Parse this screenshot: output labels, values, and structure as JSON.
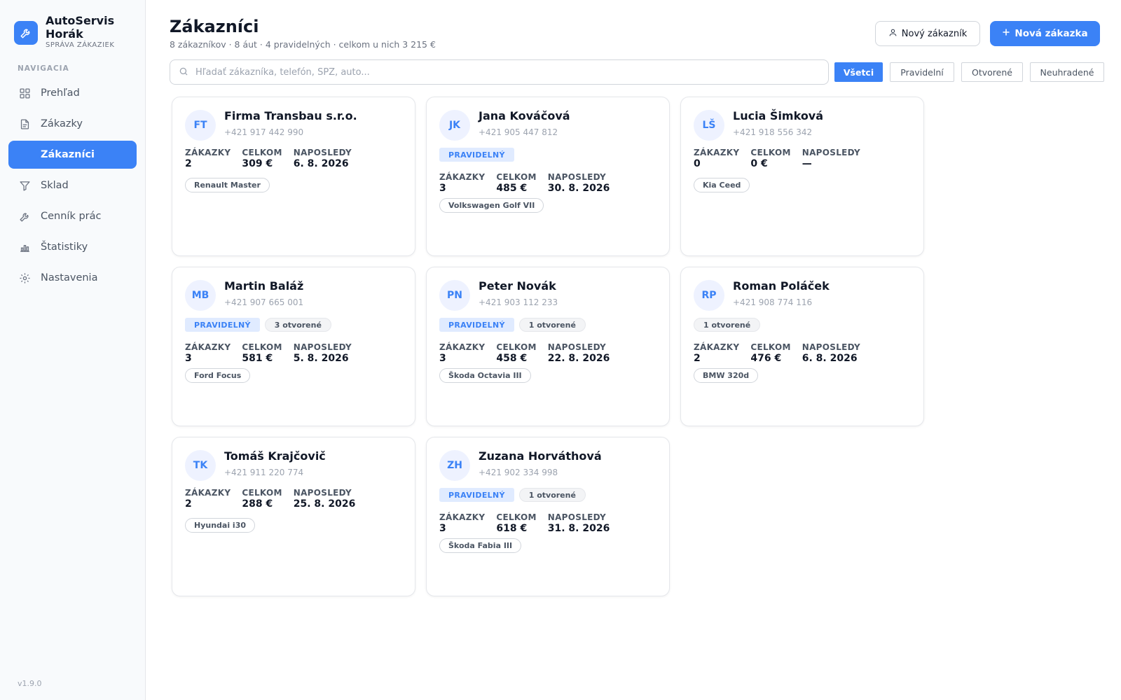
{
  "brand": {
    "name": "AutoServis Horák",
    "subtitle": "SPRÁVA ZÁKAZIEK"
  },
  "nav": {
    "heading": "NAVIGACIA",
    "items": [
      {
        "label": "Prehľad",
        "icon": "grid-icon"
      },
      {
        "label": "Zákazky",
        "icon": "document-icon"
      },
      {
        "label": "Zákazníci",
        "icon": "users-icon",
        "active": true
      },
      {
        "label": "Sklad",
        "icon": "filter-icon"
      },
      {
        "label": "Cenník prác",
        "icon": "wrench-icon"
      },
      {
        "label": "Štatistiky",
        "icon": "bar-chart-icon"
      },
      {
        "label": "Nastavenia",
        "icon": "gear-icon"
      }
    ]
  },
  "version": "v1.9.0",
  "header": {
    "title": "Zákazníci",
    "subtitle": "8 zákazníkov · 8 áut · 4 pravidelných · celkom u nich 3 215 €",
    "new_customer": "Nový zákazník",
    "new_order": "Nová zákazka"
  },
  "search": {
    "placeholder": "Hľadať zákazníka, telefón, ŠPZ, auto...",
    "value": ""
  },
  "filters": [
    "Všetci",
    "Pravidelní",
    "Otvorené",
    "Neuhradené"
  ],
  "active_filter": "Všetci",
  "labels": {
    "orders": "ZÁKAZKY",
    "total": "CELKOM",
    "last": "NAPOSLEDY"
  },
  "customers": [
    {
      "initials": "FT",
      "name": "Firma Transbau s.r.o.",
      "phone": "+421 917 442 990",
      "regular": "",
      "open": "",
      "orders": "2",
      "total": "309 €",
      "last": "6. 8. 2026",
      "car": "Renault Master"
    },
    {
      "initials": "JK",
      "name": "Jana Kováčová",
      "phone": "+421 905 447 812",
      "regular": "PRAVIDELNÝ",
      "open": "",
      "orders": "3",
      "total": "485 €",
      "last": "30. 8. 2026",
      "car": "Volkswagen Golf VII"
    },
    {
      "initials": "LŠ",
      "name": "Lucia Šimková",
      "phone": "+421 918 556 342",
      "regular": "",
      "open": "",
      "orders": "0",
      "total": "0 €",
      "last": "—",
      "car": "Kia Ceed"
    },
    {
      "initials": "MB",
      "name": "Martin Baláž",
      "phone": "+421 907 665 001",
      "regular": "PRAVIDELNÝ",
      "open": "3 otvorené",
      "orders": "3",
      "total": "581 €",
      "last": "5. 8. 2026",
      "car": "Ford Focus"
    },
    {
      "initials": "PN",
      "name": "Peter Novák",
      "phone": "+421 903 112 233",
      "regular": "PRAVIDELNÝ",
      "open": "1 otvorené",
      "orders": "3",
      "total": "458 €",
      "last": "22. 8. 2026",
      "car": "Škoda Octavia III"
    },
    {
      "initials": "RP",
      "name": "Roman Poláček",
      "phone": "+421 908 774 116",
      "regular": "",
      "open": "1 otvorené",
      "orders": "2",
      "total": "476 €",
      "last": "6. 8. 2026",
      "car": "BMW 320d"
    },
    {
      "initials": "TK",
      "name": "Tomáš Krajčovič",
      "phone": "+421 911 220 774",
      "regular": "",
      "open": "",
      "orders": "2",
      "total": "288 €",
      "last": "25. 8. 2026",
      "car": "Hyundai i30"
    },
    {
      "initials": "ZH",
      "name": "Zuzana Horváthová",
      "phone": "+421 902 334 998",
      "regular": "PRAVIDELNÝ",
      "open": "1 otvorené",
      "orders": "3",
      "total": "618 €",
      "last": "31. 8. 2026",
      "car": "Škoda Fabia III"
    }
  ],
  "colors": {
    "accent": "#3b82f6",
    "sidebar_bg": "#f8fafc",
    "badge_bg": "#e0ebff"
  }
}
